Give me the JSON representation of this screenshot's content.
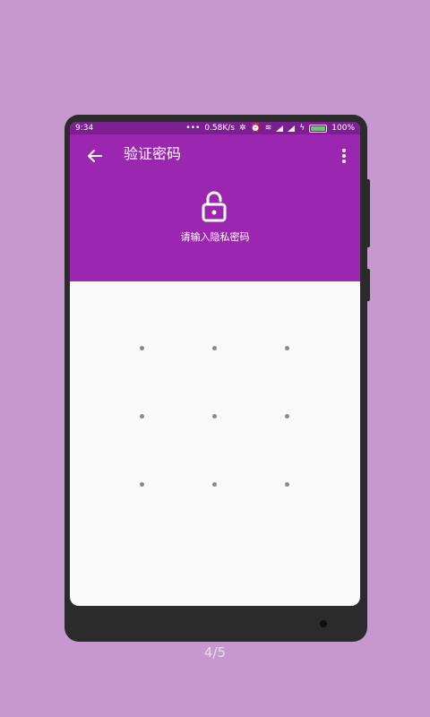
{
  "status_bar": {
    "time": "9:34",
    "network_speed": "0.58K/s",
    "battery": "100%",
    "icons": [
      "more-dots-icon",
      "bluetooth-icon",
      "alarm-icon",
      "wifi-icon",
      "signal-icon",
      "signal-icon",
      "charging-icon",
      "battery-icon"
    ]
  },
  "app_bar": {
    "title": "验证密码",
    "back_icon": "arrow-left-icon",
    "menu_icon": "more-vertical-icon"
  },
  "header": {
    "lock_icon": "unlock-icon",
    "prompt": "请输入隐私密码"
  },
  "pattern": {
    "rows": 3,
    "cols": 3
  },
  "pager": {
    "indicator": "4/5"
  },
  "colors": {
    "background": "#c698cf",
    "primary": "#9b27b0",
    "primary_dark": "#7c1f93",
    "screen": "#fafafa",
    "dot": "#8a8a8a"
  }
}
